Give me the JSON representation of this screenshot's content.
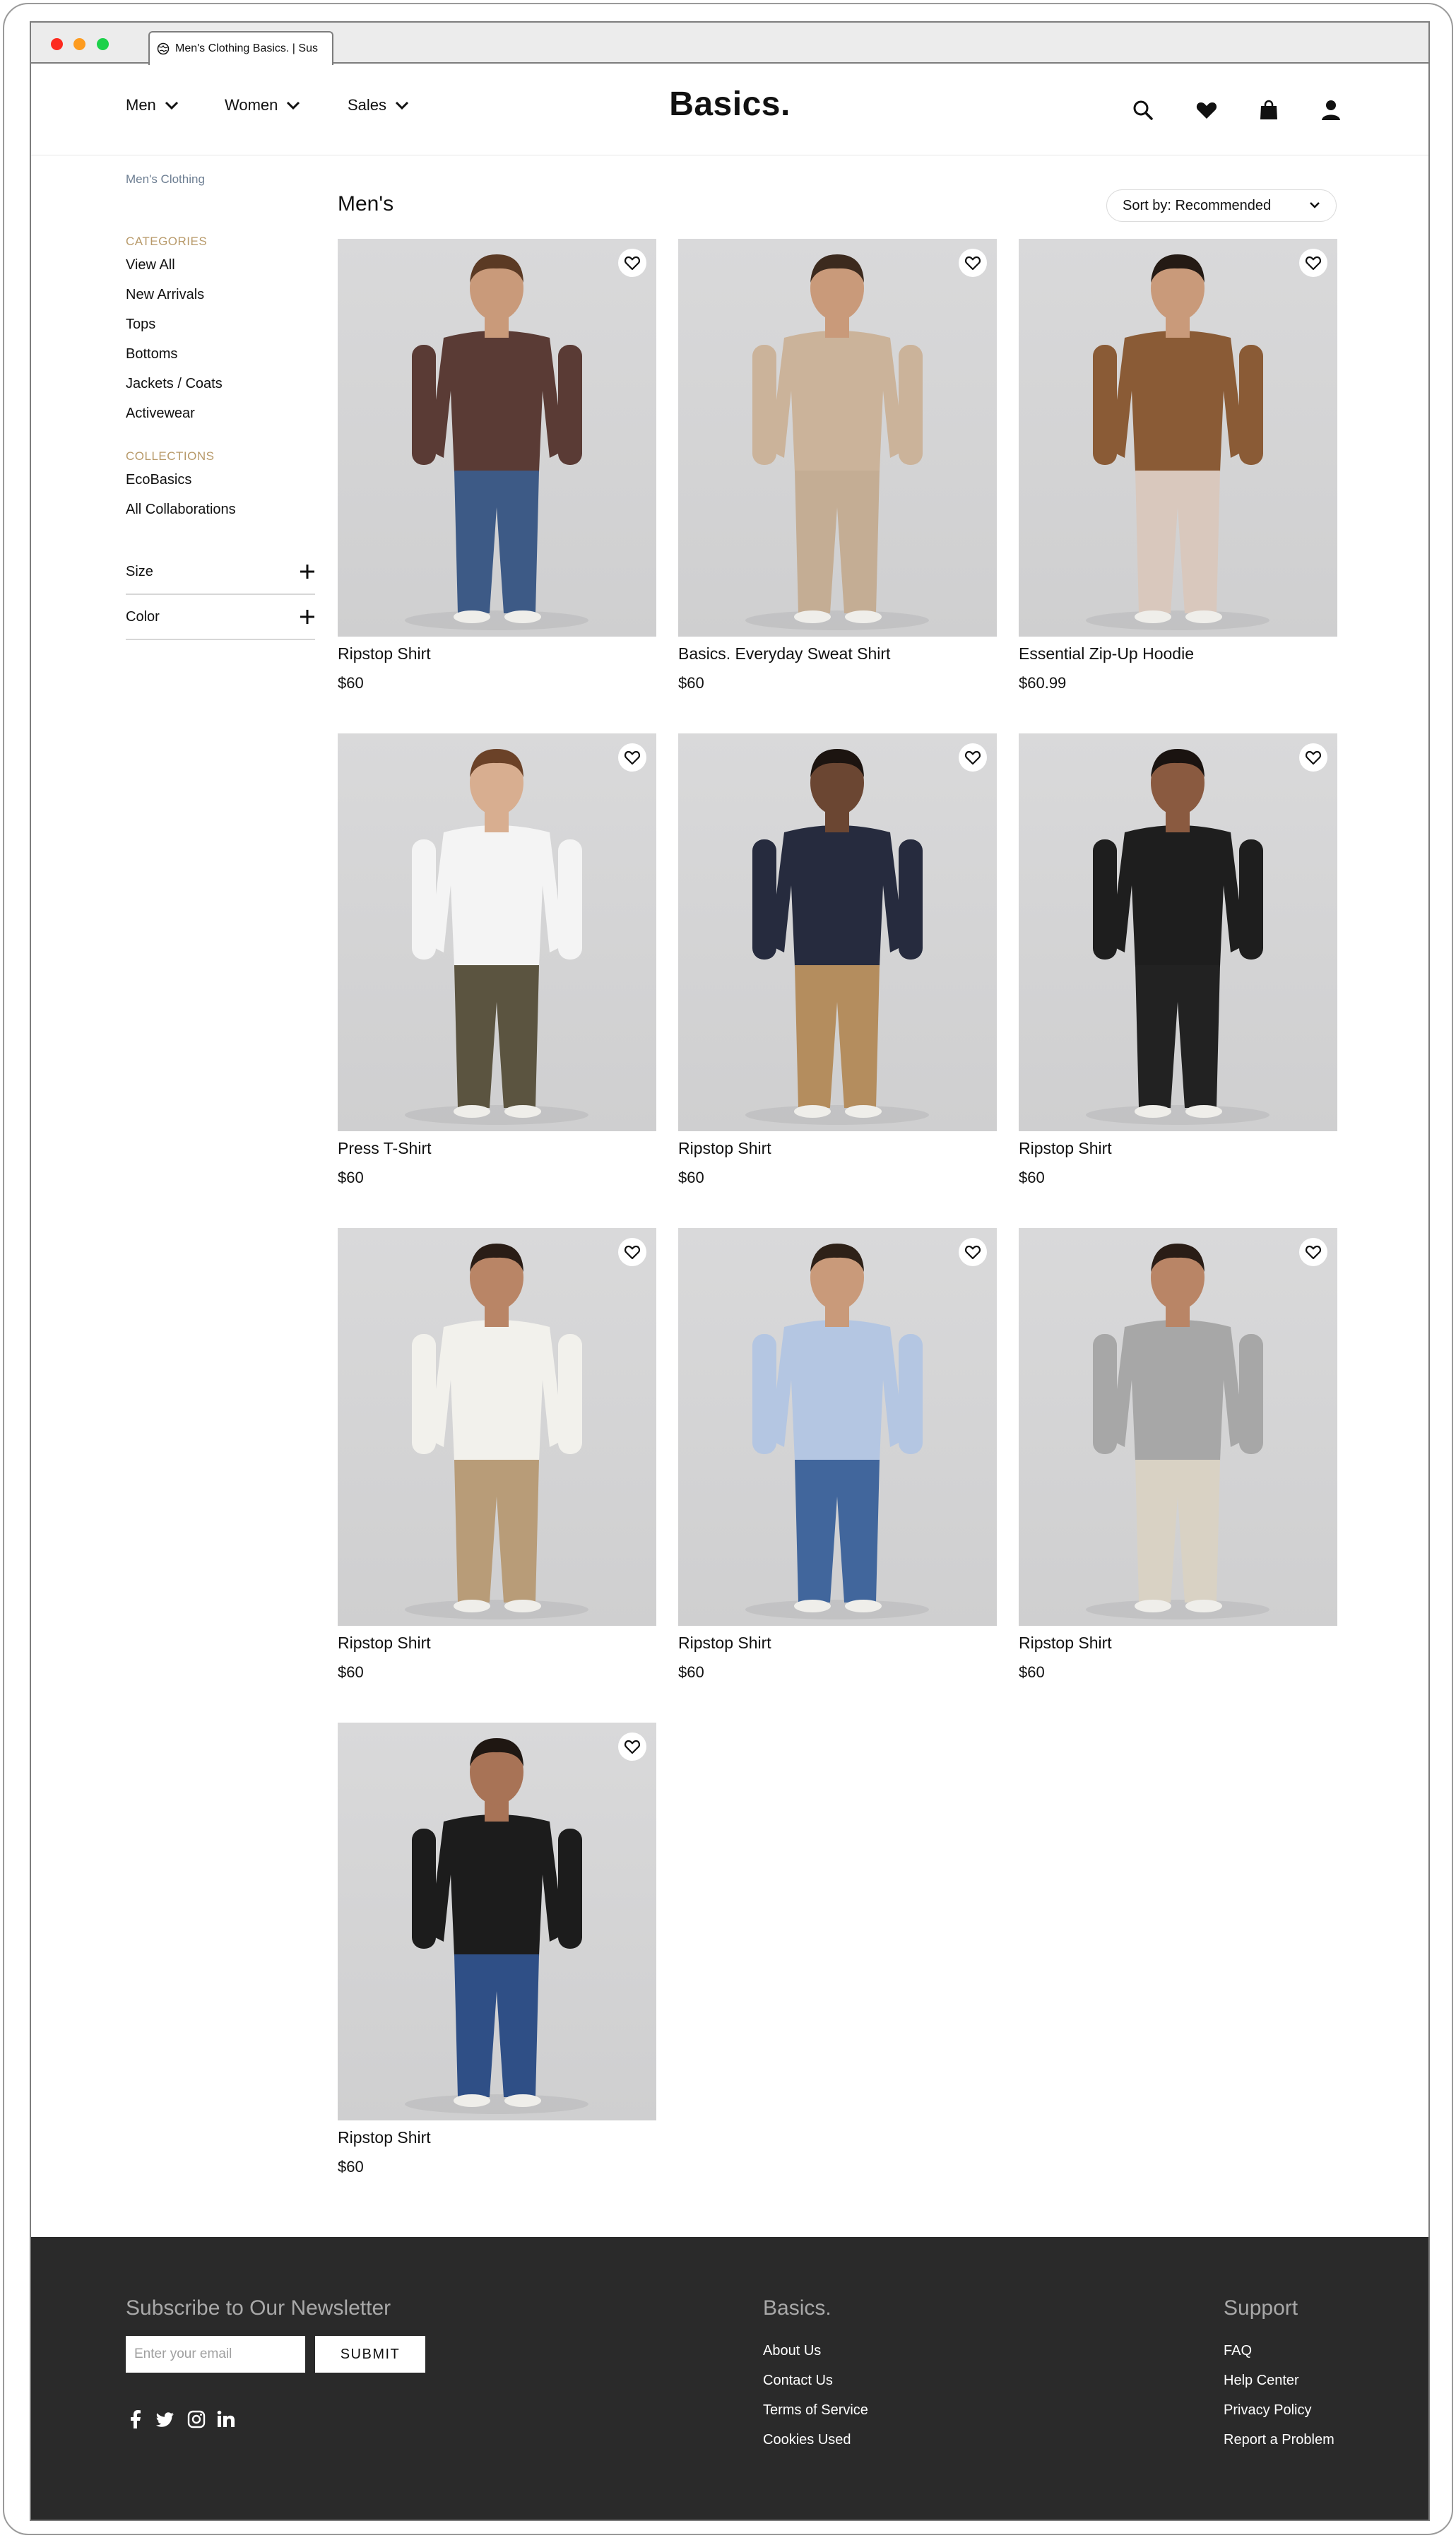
{
  "browser": {
    "tab_title": "Men's Clothing Basics. | Sus"
  },
  "header": {
    "nav": [
      {
        "label": "Men"
      },
      {
        "label": "Women"
      },
      {
        "label": "Sales"
      }
    ],
    "logo": "Basics.",
    "icons": [
      "search-icon",
      "heart-icon",
      "bag-icon",
      "user-icon"
    ]
  },
  "breadcrumb": "Men's Clothing",
  "sidebar": {
    "categories_heading": "CATEGORIES",
    "categories": [
      "View All",
      "New Arrivals",
      "Tops",
      "Bottoms",
      "Jackets / Coats",
      "Activewear"
    ],
    "collections_heading": "COLLECTIONS",
    "collections": [
      "EcoBasics",
      "All Collaborations"
    ],
    "filters": [
      "Size",
      "Color"
    ]
  },
  "main": {
    "title": "Men's",
    "sort_label": "Sort by: Recommended",
    "products": [
      {
        "name": "Ripstop Shirt",
        "price": "$60",
        "top": "#5a3b35",
        "bottom": "#3d5a86",
        "skin": "#c99a7a",
        "hair": "#5b3a24"
      },
      {
        "name": "Basics. Everyday Sweat Shirt",
        "price": "$60",
        "top": "#cbb39a",
        "bottom": "#c4ad94",
        "skin": "#c99a7a",
        "hair": "#3c2a1e"
      },
      {
        "name": "Essential Zip-Up Hoodie",
        "price": "$60.99",
        "top": "#8a5b36",
        "bottom": "#d9c8bd",
        "skin": "#c99a7a",
        "hair": "#241a14"
      },
      {
        "name": "Press T-Shirt",
        "price": "$60",
        "top": "#f4f4f4",
        "bottom": "#5b5440",
        "skin": "#d8ae90",
        "hair": "#6b4228"
      },
      {
        "name": "Ripstop Shirt",
        "price": "$60",
        "top": "#262b3e",
        "bottom": "#b48d5e",
        "skin": "#6b4632",
        "hair": "#1c1410"
      },
      {
        "name": "Ripstop Shirt",
        "price": "$60",
        "top": "#1e1e1e",
        "bottom": "#222222",
        "skin": "#8a5a40",
        "hair": "#1a1310"
      },
      {
        "name": "Ripstop Shirt",
        "price": "$60",
        "top": "#f2f1ec",
        "bottom": "#b89c78",
        "skin": "#b98566",
        "hair": "#2a1d16"
      },
      {
        "name": "Ripstop Shirt",
        "price": "$60",
        "top": "#b4c6e2",
        "bottom": "#41669c",
        "skin": "#c99a7a",
        "hair": "#2e2118"
      },
      {
        "name": "Ripstop Shirt",
        "price": "$60",
        "top": "#a7a7a7",
        "bottom": "#d9d2c4",
        "skin": "#b98566",
        "hair": "#2a1d16"
      },
      {
        "name": "Ripstop Shirt",
        "price": "$60",
        "top": "#1c1c1c",
        "bottom": "#2f4f86",
        "skin": "#a87356",
        "hair": "#1f1712"
      }
    ]
  },
  "footer": {
    "newsletter_heading": "Subscribe to Our Newsletter",
    "email_placeholder": "Enter your email",
    "submit_label": "SUBMIT",
    "social": [
      "facebook-icon",
      "twitter-icon",
      "instagram-icon",
      "linkedin-icon"
    ],
    "brand_heading": "Basics.",
    "brand_links": [
      "About Us",
      "Contact Us",
      "Terms of Service",
      "Cookies Used"
    ],
    "support_heading": "Support",
    "support_links": [
      "FAQ",
      "Help Center",
      "Privacy Policy",
      "Report a Problem"
    ]
  },
  "colors": {
    "accent_heading": "#b89a6a",
    "breadcrumb": "#6d7e92",
    "footer_bg": "#2a2a2a"
  }
}
